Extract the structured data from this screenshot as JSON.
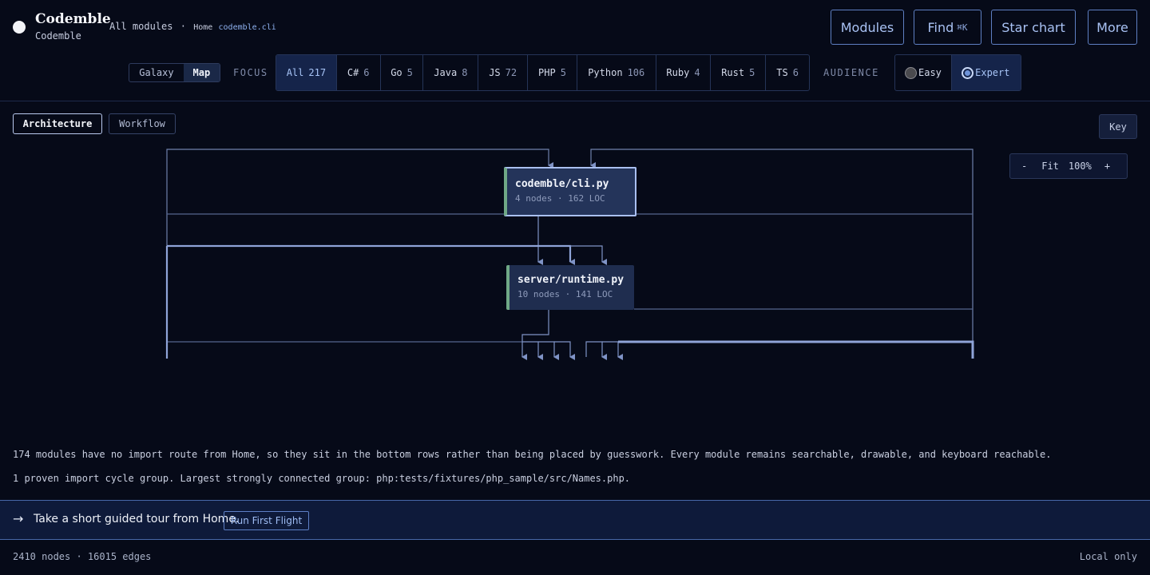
{
  "brand": {
    "title": "Codemble",
    "subtitle": "Codemble"
  },
  "breadcrumb": {
    "root": "All modules",
    "separator": "·",
    "home": "Home",
    "current": "codemble.cli"
  },
  "header_buttons": {
    "modules": "Modules",
    "find": "Find",
    "find_shortcut": "⌘K",
    "star_chart": "Star chart",
    "more": "More"
  },
  "view_toggle": {
    "galaxy": "Galaxy",
    "map": "Map",
    "selected": "Map"
  },
  "focus": {
    "label": "FOCUS",
    "chips": [
      {
        "label": "All",
        "count": "217",
        "active": true
      },
      {
        "label": "C#",
        "count": "6"
      },
      {
        "label": "Go",
        "count": "5"
      },
      {
        "label": "Java",
        "count": "8"
      },
      {
        "label": "JS",
        "count": "72"
      },
      {
        "label": "PHP",
        "count": "5"
      },
      {
        "label": "Python",
        "count": "106"
      },
      {
        "label": "Ruby",
        "count": "4"
      },
      {
        "label": "Rust",
        "count": "5"
      },
      {
        "label": "TS",
        "count": "6"
      }
    ]
  },
  "audience": {
    "label": "AUDIENCE",
    "easy": "Easy",
    "expert": "Expert",
    "selected": "Expert"
  },
  "subtabs": {
    "architecture": "Architecture",
    "workflow": "Workflow",
    "selected": "Architecture"
  },
  "key_button": "Key",
  "zoom": {
    "minus": "-",
    "fit": "Fit",
    "level": "100%",
    "plus": "+"
  },
  "graph": {
    "nodes": [
      {
        "title": "codemble/cli.py",
        "meta": "4 nodes · 162 LOC",
        "selected": true
      },
      {
        "title": "server/runtime.py",
        "meta": "10 nodes · 141 LOC"
      }
    ]
  },
  "notes": {
    "unplaced": "174 modules have no import route from Home, so they sit in the bottom rows rather than being placed by guesswork. Every module remains searchable, drawable, and keyboard reachable.",
    "cycles": "1 proven import cycle group. Largest strongly connected group: php:tests/fixtures/php_sample/src/Names.php."
  },
  "tour": {
    "arrow": "→",
    "text": "Take a short guided tour from Home.",
    "button": "Run First Flight"
  },
  "footer": {
    "stats": "2410 nodes · 16015 edges",
    "local": "Local only"
  },
  "colors": {
    "background": "#060a18",
    "accent": "#a7c4f7",
    "node_fill": "#1f2d4f",
    "node_stripe": "#6fa886",
    "edge": "#7f93c6"
  }
}
